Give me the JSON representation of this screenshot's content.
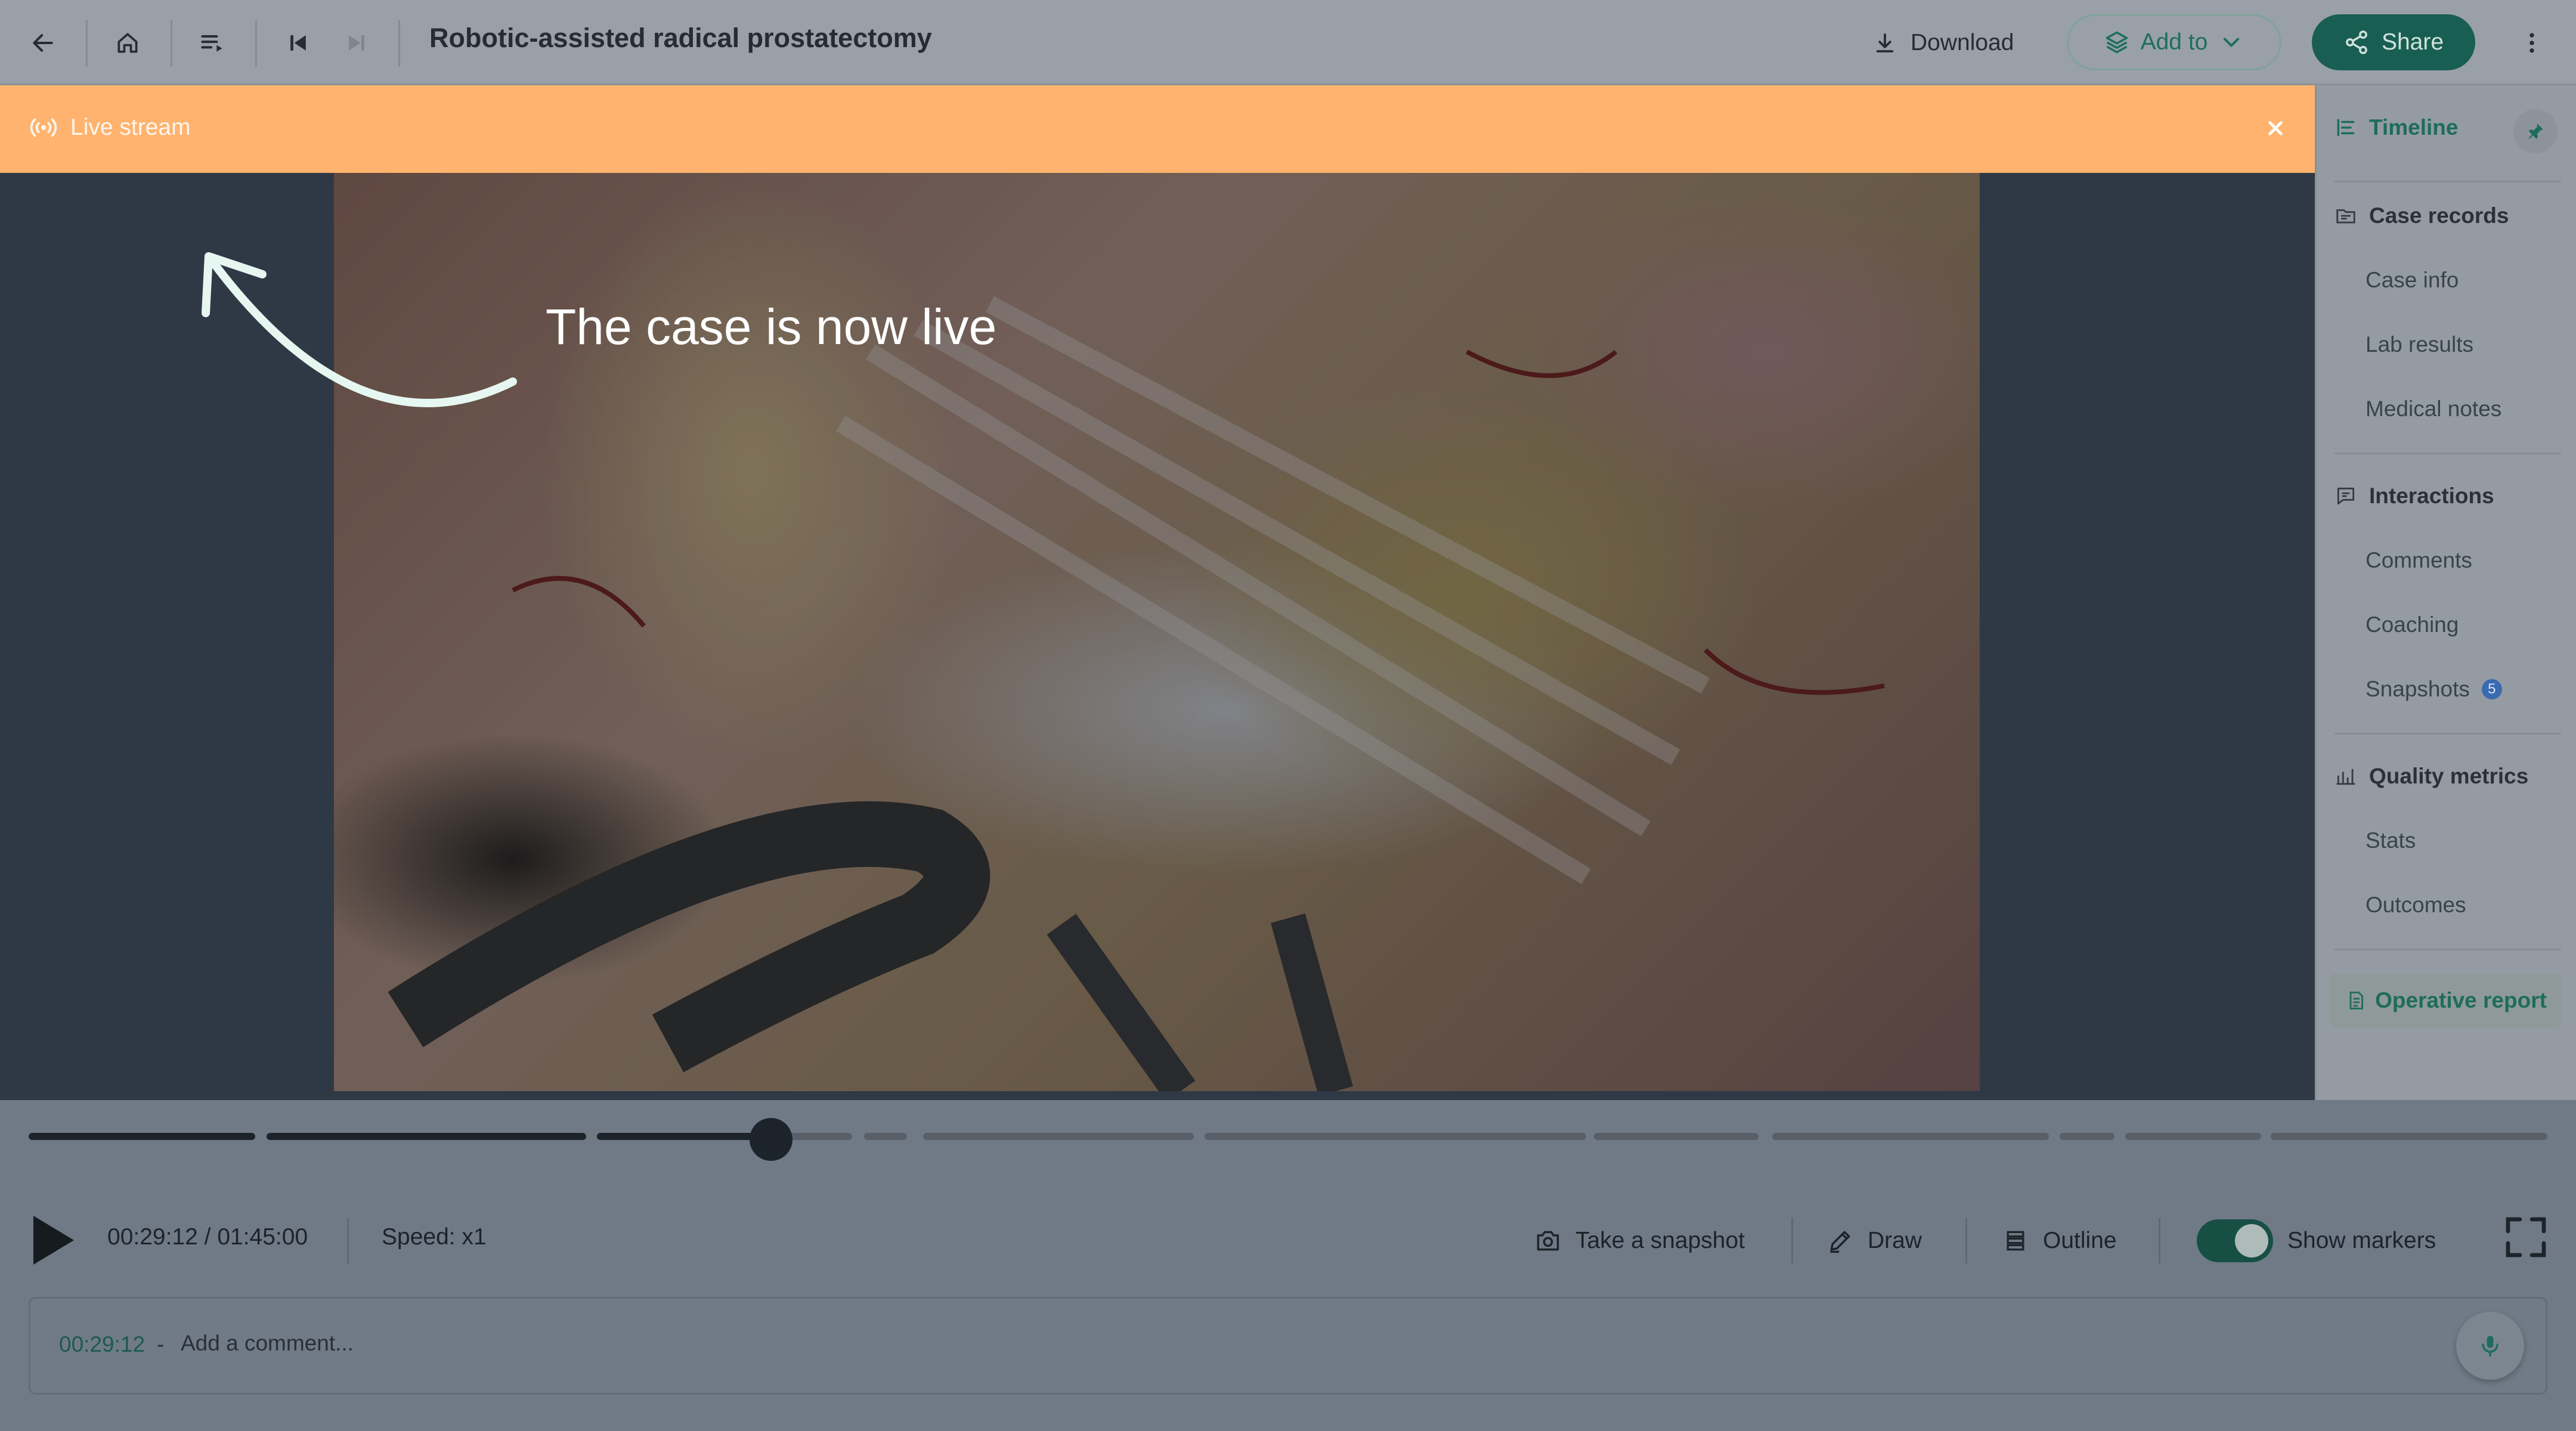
{
  "header": {
    "title": "Robotic-assisted radical prostatectomy",
    "download_label": "Download",
    "add_to_label": "Add to",
    "share_label": "Share"
  },
  "banner": {
    "label": "Live stream",
    "close_icon": "close-icon",
    "background": "#ffb36e"
  },
  "overlay": {
    "message": "The case is now live"
  },
  "sidebar": {
    "timeline_label": "Timeline",
    "sections": [
      {
        "label": "Case records",
        "items": [
          "Case info",
          "Lab results",
          "Medical notes"
        ]
      },
      {
        "label": "Interactions",
        "items": [
          "Comments",
          "Coaching",
          "Snapshots"
        ]
      },
      {
        "label": "Quality metrics",
        "items": [
          "Stats",
          "Outcomes"
        ]
      }
    ],
    "snapshots_badge": "5",
    "operative_report_label": "Operative report"
  },
  "player": {
    "current_time": "00:29:12",
    "duration": "01:45:00",
    "time_display": "00:29:12 / 01:45:00",
    "speed_label": "Speed:",
    "speed_value": "x1",
    "snapshot_label": "Take a snapshot",
    "draw_label": "Draw",
    "outline_label": "Outline",
    "show_markers_label": "Show markers",
    "show_markers_enabled": true,
    "progress_fraction": 0.278
  },
  "comment": {
    "timestamp": "00:29:12",
    "separator": "-",
    "placeholder": "Add a comment..."
  },
  "colors": {
    "accent": "#195e52",
    "banner": "#ffb36e",
    "badge": "#3a6ab0"
  }
}
